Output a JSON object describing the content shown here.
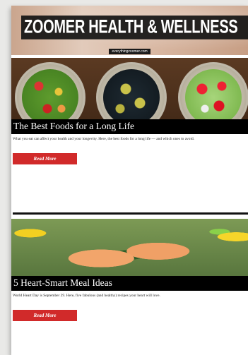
{
  "header": {
    "brand": "ZOOMER HEALTH & WELLNESS",
    "tagline": "everythingzoomer.com"
  },
  "articles": [
    {
      "title": "The Best Foods for a Long Life",
      "excerpt": "What you eat can affect your health and your longevity. Here, the best foods for a long life — and which ones to avoid.",
      "cta": "Read More"
    },
    {
      "title": "5 Heart-Smart Meal Ideas",
      "excerpt": "World Heart Day is September 29. Here, five fabulous (and healthy) recipes your heart will love.",
      "cta": "Read More"
    }
  ]
}
